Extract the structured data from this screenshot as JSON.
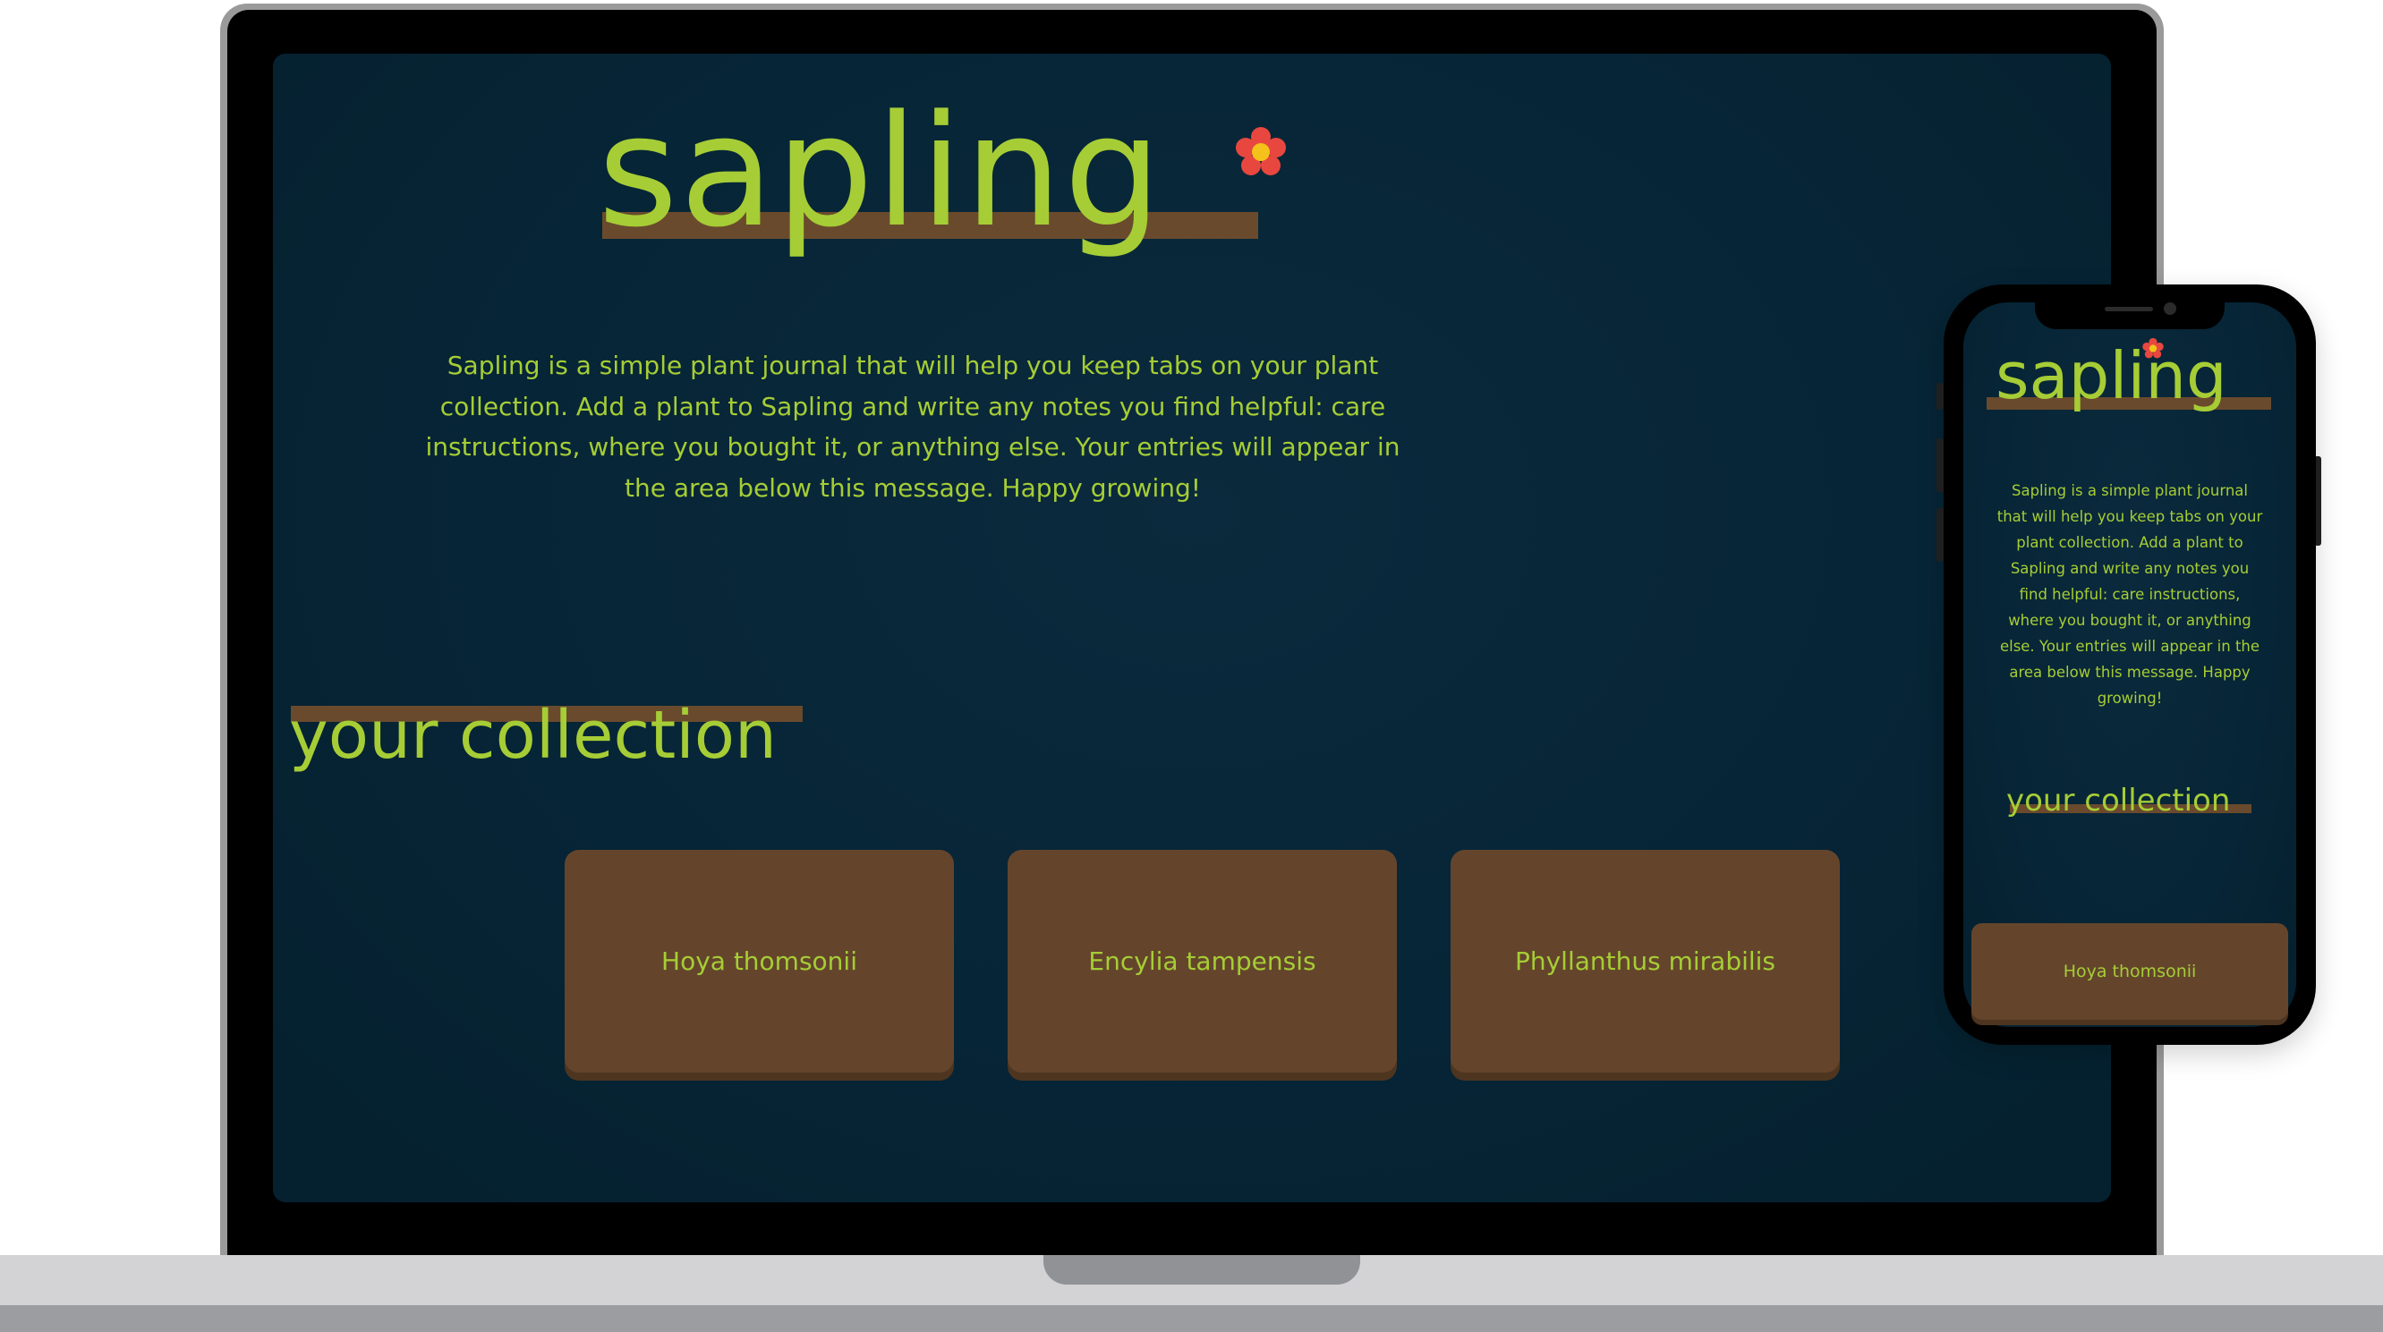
{
  "app": {
    "title": "sapling",
    "intro": "Sapling is a simple plant journal that will help you keep tabs on your plant collection. Add a plant to Sapling and write any notes you find helpful: care instructions, where you bought it, or anything else. Your entries will appear in the area below this message. Happy growing!",
    "collection_heading": "your collection",
    "accent_color": "#a6cd35",
    "card_color": "#64452c",
    "background_color": "#062536",
    "logo_icon": "flower-icon"
  },
  "desktop": {
    "plants": [
      {
        "name": "Hoya thomsonii"
      },
      {
        "name": "Encylia tampensis"
      },
      {
        "name": "Phyllanthus mirabilis"
      }
    ]
  },
  "mobile": {
    "plants": [
      {
        "name": "Hoya thomsonii"
      }
    ]
  }
}
